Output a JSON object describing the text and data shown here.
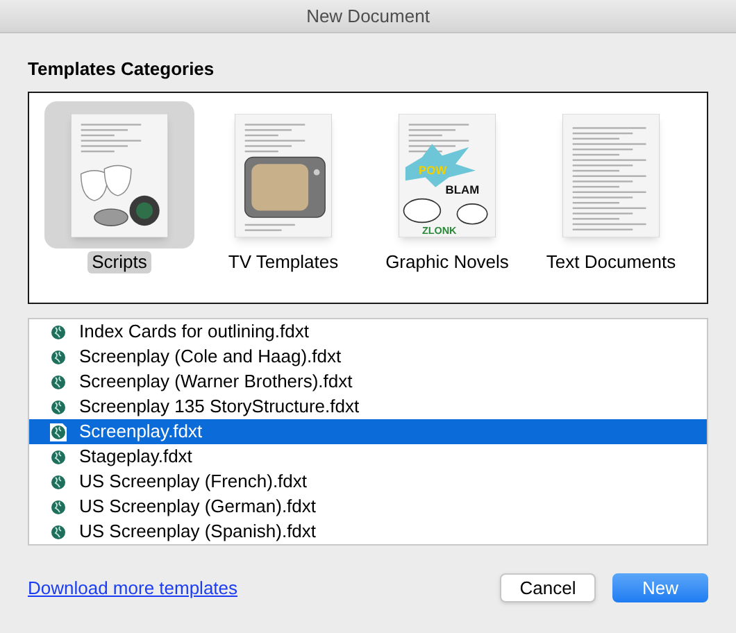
{
  "window": {
    "title": "New Document"
  },
  "categories_heading": "Templates Categories",
  "categories": [
    {
      "label": "Scripts",
      "kind": "scripts",
      "selected": true
    },
    {
      "label": "TV Templates",
      "kind": "tv",
      "selected": false
    },
    {
      "label": "Graphic Novels",
      "kind": "comic",
      "selected": false,
      "artwork_text": [
        "POW",
        "BLAM",
        "ZLONK"
      ]
    },
    {
      "label": "Text Documents",
      "kind": "text",
      "selected": false
    }
  ],
  "templates": [
    {
      "name": "Index Cards for outlining.fdxt",
      "selected": false
    },
    {
      "name": "Screenplay (Cole and Haag).fdxt",
      "selected": false
    },
    {
      "name": "Screenplay (Warner Brothers).fdxt",
      "selected": false
    },
    {
      "name": "Screenplay 135 StoryStructure.fdxt",
      "selected": false
    },
    {
      "name": "Screenplay.fdxt",
      "selected": true
    },
    {
      "name": "Stageplay.fdxt",
      "selected": false
    },
    {
      "name": "US Screenplay (French).fdxt",
      "selected": false
    },
    {
      "name": "US Screenplay (German).fdxt",
      "selected": false
    },
    {
      "name": "US Screenplay (Spanish).fdxt",
      "selected": false
    }
  ],
  "download_link": "Download more templates",
  "buttons": {
    "cancel": "Cancel",
    "confirm": "New"
  }
}
